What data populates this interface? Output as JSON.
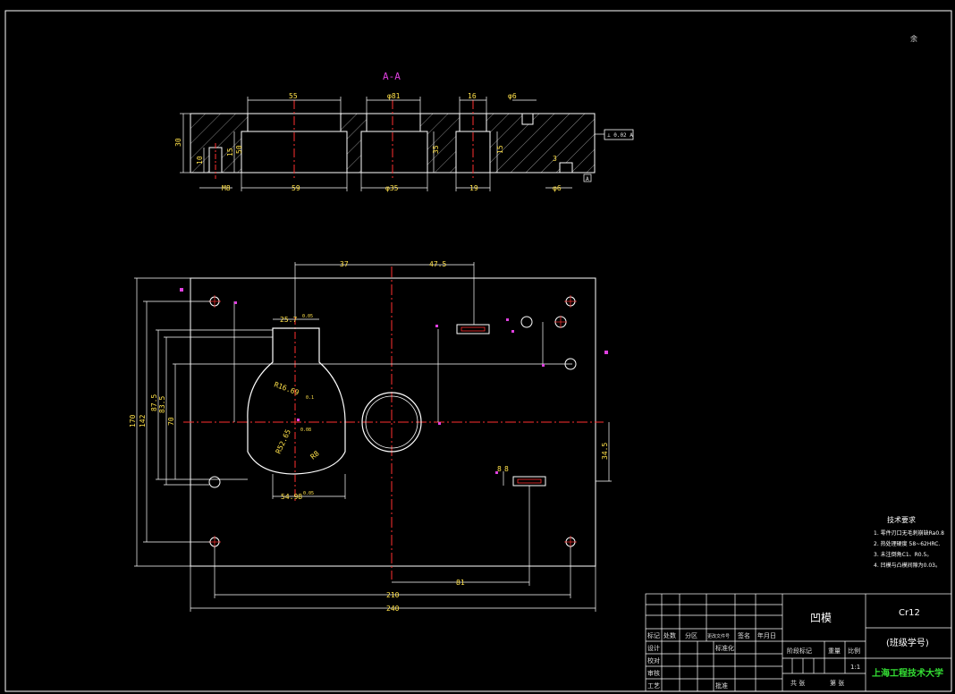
{
  "section_label": "A-A",
  "corner_mark": "余",
  "top_view_dims": {
    "d55": "55",
    "d81": "φ81",
    "d16": "16",
    "d6": "φ6",
    "d30": "30",
    "d50": "50",
    "dm8": "M8",
    "d59": "59",
    "d35": "φ35",
    "d19": "19",
    "d15b": "φ6",
    "d10": "10",
    "d15": "15",
    "d3": "3",
    "d35v": "35",
    "d15v": "15",
    "flat": "⊥ 0.02 A",
    "datum": "A"
  },
  "plan_dims": {
    "d37": "37",
    "d47": "47.5",
    "d25": "25.7",
    "d25t": "0.05",
    "r16": "R16.69",
    "r16t": "0.1",
    "r52": "R52.65",
    "r52t": "0.08",
    "r8": "R8",
    "d54": "54.98",
    "d54t": "0.05",
    "d170": "170",
    "d142": "142",
    "d87": "87.5",
    "d83": "83.5",
    "d70": "70",
    "d34": "34.5",
    "d210": "210",
    "d240": "240",
    "d81": "81",
    "d8a": "8",
    "d8b": "8"
  },
  "notes": {
    "title": "技术要求",
    "items": [
      "1. 零件刃口无毛刺崩缺Ra0.8",
      "2. 热处理硬度 58~62HRC.",
      "3. 未注倒角C1、R0.5。",
      "4. 凹模与凸模间隙为0.03。"
    ]
  },
  "title_block": {
    "part_name": "凹模",
    "material": "Cr12",
    "class_no": "(班级学号)",
    "school": "上海工程技术大学",
    "scale": "1:1",
    "row_labels": [
      "标记",
      "处数",
      "分区",
      "更改文件号",
      "签名",
      "年月日"
    ],
    "design": "设计",
    "std": "标准化",
    "check": "校对",
    "review": "审核",
    "process": "工艺",
    "approve": "批准",
    "stage": "阶段标记",
    "weight": "重量",
    "ratio": "比例",
    "sheets": "共  张",
    "sheet": "第  张"
  }
}
